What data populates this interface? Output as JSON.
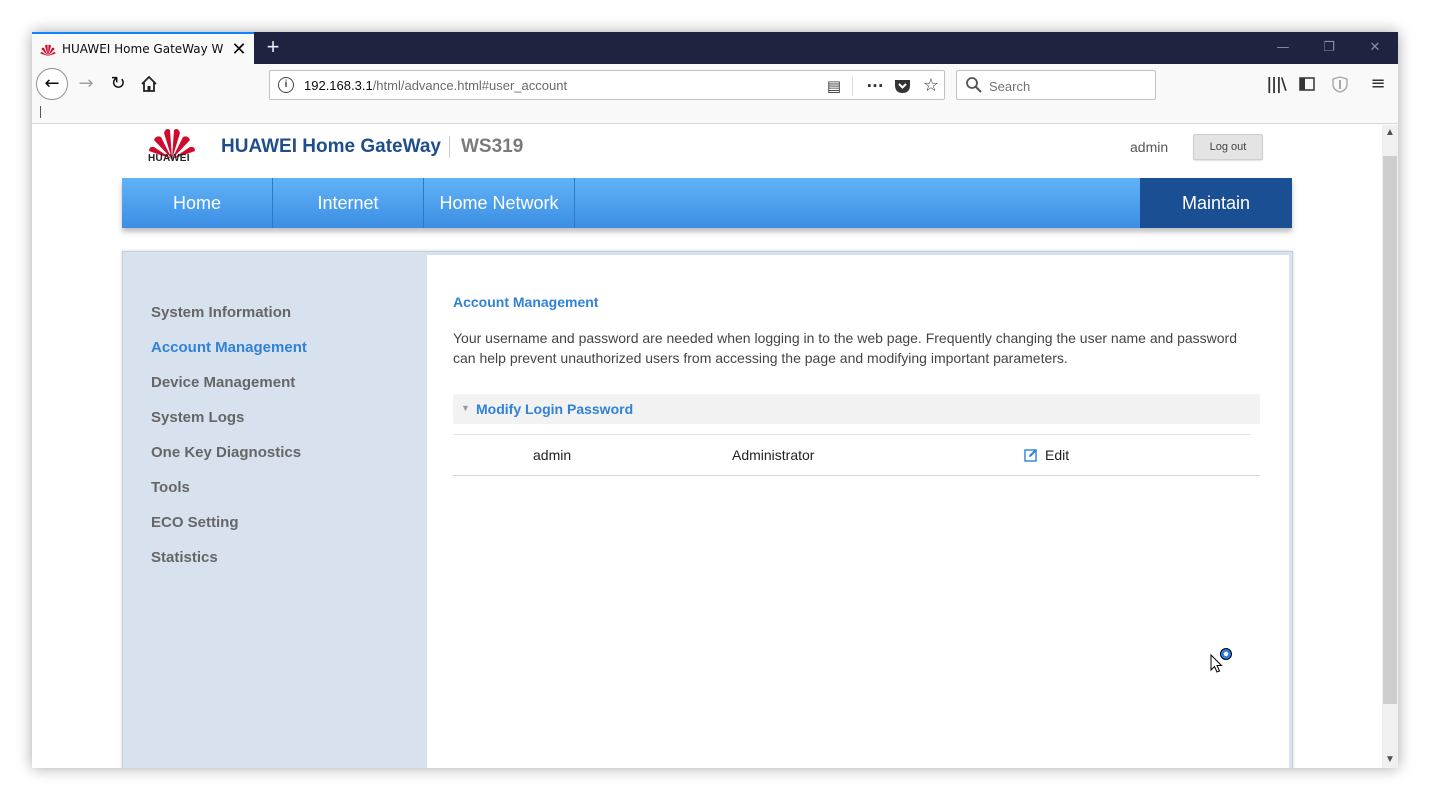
{
  "browser": {
    "tab_title": "HUAWEI Home GateWay WS319",
    "tab_close": "✕",
    "new_tab": "+",
    "url_host": "192.168.3.1",
    "url_path": "/html/advance.html#user_account",
    "search_placeholder": "Search",
    "window_controls": {
      "minimize": "—",
      "restore": "❐",
      "close": "✕"
    }
  },
  "header": {
    "logo_text": "HUAWEI",
    "brand": "HUAWEI Home GateWay",
    "model": "WS319",
    "user": "admin",
    "logout": "Log out"
  },
  "nav": {
    "items": [
      "Home",
      "Internet",
      "Home Network"
    ],
    "active": "Maintain"
  },
  "sidebar": {
    "items": [
      "System Information",
      "Account Management",
      "Device Management",
      "System Logs",
      "One Key Diagnostics",
      "Tools",
      "ECO Setting",
      "Statistics"
    ],
    "active_index": 1
  },
  "panel": {
    "title": "Account Management",
    "description": "Your username and password are needed when logging in to the web page. Frequently changing the user name and password can help prevent unauthorized users from accessing the page and modifying important parameters.",
    "section_title": "Modify Login Password",
    "row": {
      "username": "admin",
      "role": "Administrator",
      "edit": "Edit"
    }
  },
  "colors": {
    "accent": "#2f82d6",
    "nav_active": "#1b4f93",
    "nav_gradient_top": "#61b3f7",
    "brand": "#1f4f8a",
    "sidebar_bg": "#d8e2ee",
    "huawei_red": "#cf0a2c"
  },
  "icons": {
    "back": "arrow-left-icon",
    "forward": "arrow-right-icon",
    "reload": "reload-icon",
    "home": "home-icon",
    "info": "info-icon",
    "reader": "reader-view-icon",
    "more": "more-icon",
    "pocket": "pocket-icon",
    "bookmark": "star-icon",
    "library": "library-icon",
    "sidebar": "sidebar-icon",
    "shield": "shield-icon",
    "menu": "hamburger-menu-icon",
    "edit": "edit-icon",
    "cursor": "busy-cursor-icon"
  }
}
